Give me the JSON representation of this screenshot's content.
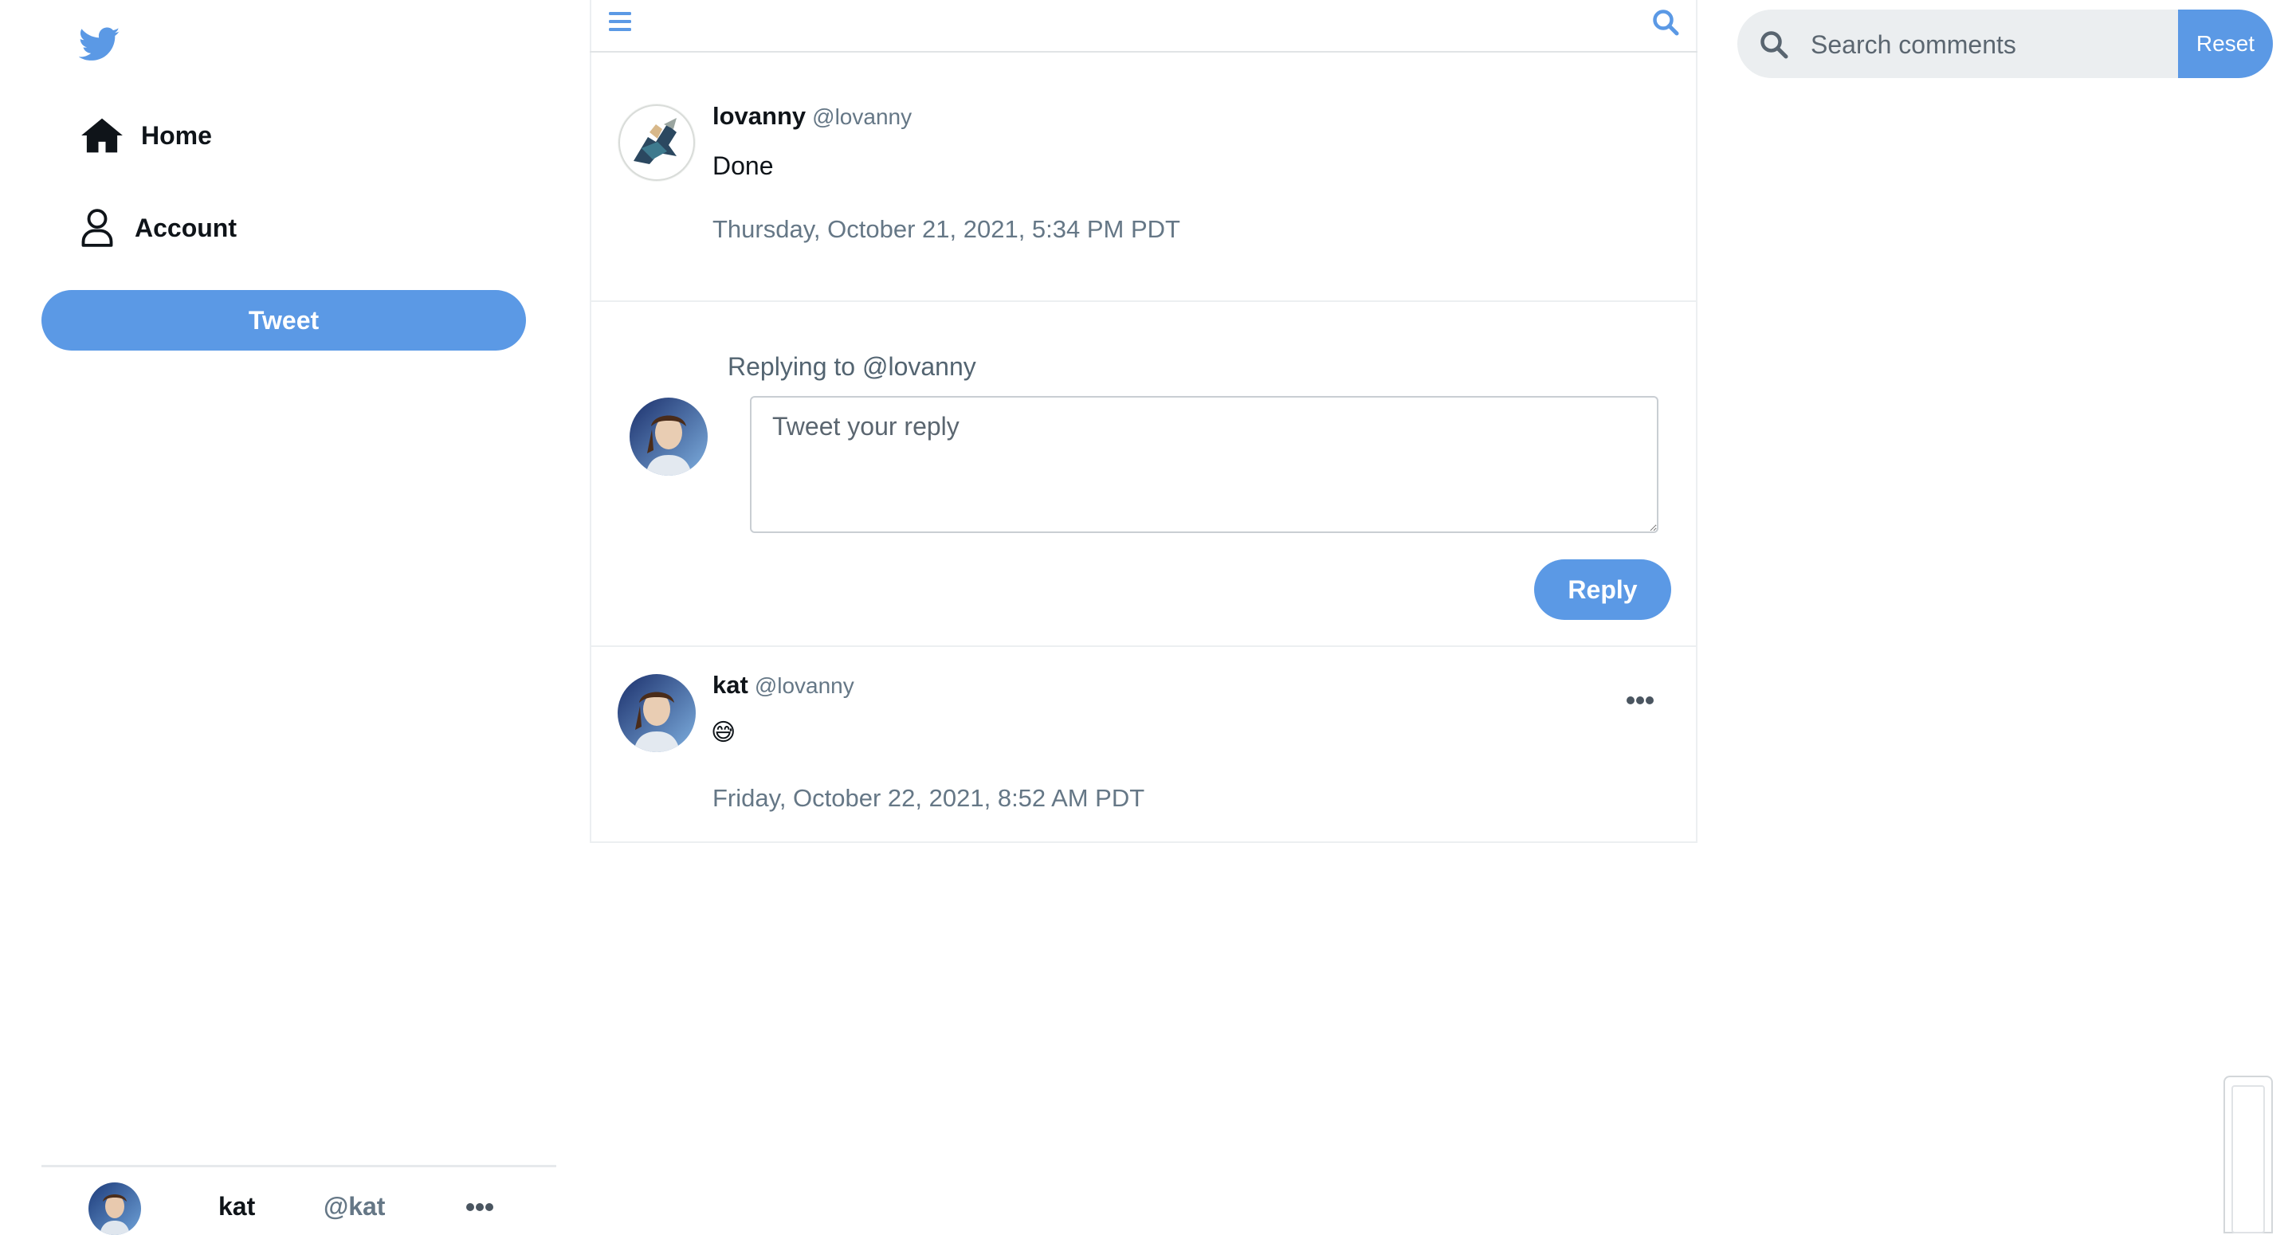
{
  "sidebar": {
    "logo_icon": "twitter-bird-icon",
    "nav": [
      {
        "label": "Home",
        "icon": "home-icon"
      },
      {
        "label": "Account",
        "icon": "user-icon"
      }
    ],
    "tweet_button": "Tweet",
    "account": {
      "name": "kat",
      "handle": "@kat",
      "more_icon": "more-icon"
    }
  },
  "main": {
    "topbar": {
      "menu_icon": "menu-icon",
      "search_icon": "search-icon"
    },
    "original_tweet": {
      "name": "lovanny",
      "handle": "@lovanny",
      "text": "Done",
      "timestamp": "Thursday, October 21, 2021, 5:34 PM PDT"
    },
    "reply_box": {
      "replying_to": "Replying to @lovanny",
      "placeholder": "Tweet your reply",
      "button": "Reply"
    },
    "comments": [
      {
        "name": "kat",
        "handle": "@lovanny",
        "text": "😅",
        "timestamp": "Friday, October 22, 2021, 8:52 AM PDT"
      }
    ]
  },
  "right": {
    "search_placeholder": "Search comments",
    "reset_button": "Reset"
  },
  "colors": {
    "accent": "#5b99e5",
    "muted": "#657786",
    "divider": "#eceff1"
  }
}
